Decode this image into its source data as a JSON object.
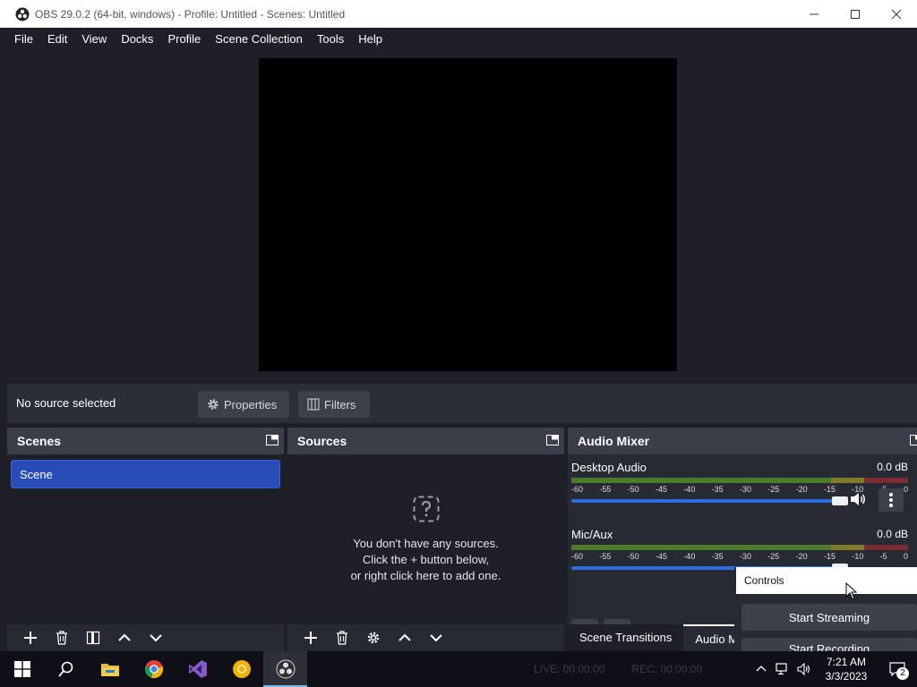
{
  "window": {
    "title": "OBS 29.0.2 (64-bit, windows) - Profile: Untitled - Scenes: Untitled"
  },
  "menu": [
    "File",
    "Edit",
    "View",
    "Docks",
    "Profile",
    "Scene Collection",
    "Tools",
    "Help"
  ],
  "context_bar": {
    "no_source": "No source selected",
    "properties": "Properties",
    "filters": "Filters"
  },
  "scenes": {
    "title": "Scenes",
    "items": [
      "Scene"
    ]
  },
  "sources": {
    "title": "Sources",
    "empty_line1": "You don't have any sources.",
    "empty_line2": "Click the + button below,",
    "empty_line3": "or right click here to add one."
  },
  "audio_mixer": {
    "title": "Audio Mixer",
    "channels": [
      {
        "name": "Desktop Audio",
        "db": "0.0 dB",
        "volume": 1.0
      },
      {
        "name": "Mic/Aux",
        "db": "0.0 dB",
        "volume": 1.0
      }
    ],
    "ticks": [
      "-60",
      "-55",
      "-50",
      "-45",
      "-40",
      "-35",
      "-30",
      "-25",
      "-20",
      "-15",
      "-10",
      "-5",
      "0"
    ]
  },
  "bottom_tabs": [
    "Scene Transitions",
    "Audio M"
  ],
  "controls": {
    "title": "Controls",
    "start_streaming": "Start Streaming",
    "start_recording": "Start Recording"
  },
  "status": {
    "live": "LIVE: 00:00:00",
    "rec": "REC: 00:00:00"
  },
  "taskbar": {
    "time": "7:21 AM",
    "date": "3/3/2023",
    "notifications": "2"
  },
  "colors": {
    "background": "#1e1f29",
    "dock_header": "#3b3e49",
    "selected_scene": "#284cb8",
    "slider": "#2c6ee0"
  }
}
